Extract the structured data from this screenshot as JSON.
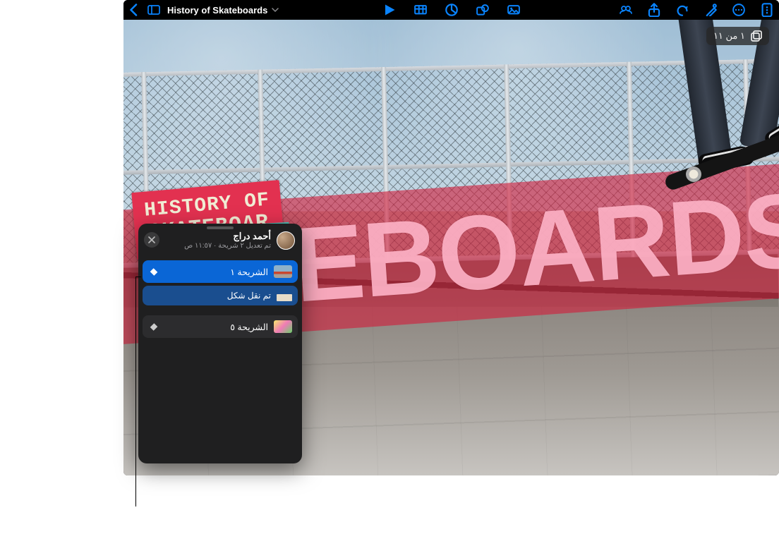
{
  "toolbar": {
    "doc_title": "History of Skateboards"
  },
  "slide_badge": {
    "text": "١ من ١١"
  },
  "history_card": {
    "line1": "HISTORY OF",
    "line2": "SKATEBOAR"
  },
  "banner": {
    "text": "TEBOARDS"
  },
  "panel": {
    "user_name": "أحمد دراج",
    "subtitle": "تم تعديل ٢ شريحة  ·  ١١:٥٧ ص",
    "items": [
      {
        "id": "slide1",
        "label": "الشريحة ١",
        "kind": "selected"
      },
      {
        "id": "change1",
        "label": "تم نقل شكل",
        "kind": "sub"
      },
      {
        "id": "slide5",
        "label": "الشريحة ٥",
        "kind": "other"
      }
    ]
  }
}
